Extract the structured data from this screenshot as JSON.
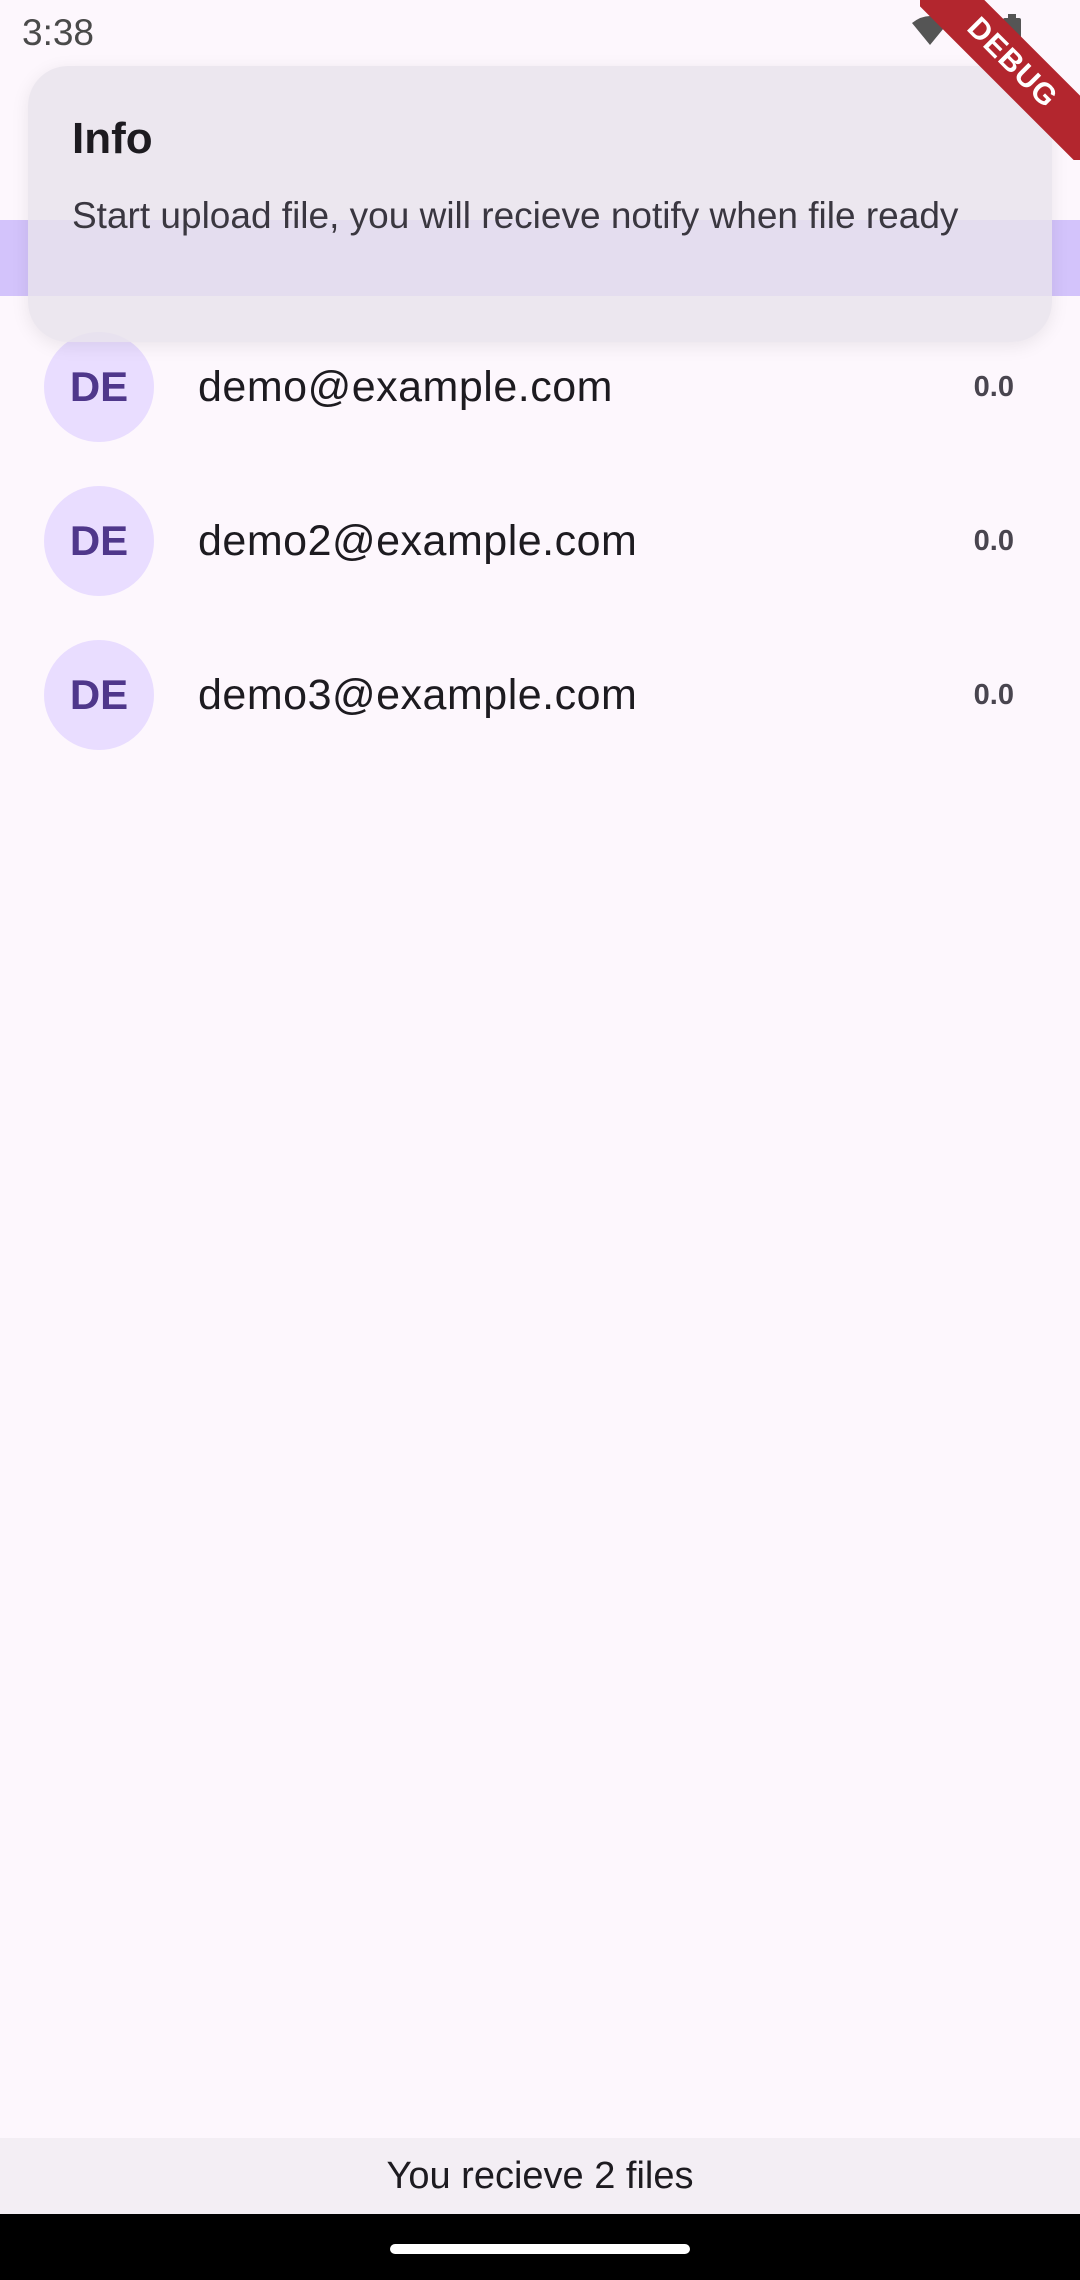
{
  "status_bar": {
    "time": "3:38",
    "icons": [
      "wifi-icon",
      "signal-icon",
      "battery-icon"
    ]
  },
  "debug_banner": {
    "label": "DEBUG"
  },
  "toast": {
    "title": "Info",
    "message": "Start upload file, you will recieve notify when file ready"
  },
  "list": {
    "items": [
      {
        "avatar": "DE",
        "email": "demo@example.com",
        "amount": "0.0"
      },
      {
        "avatar": "DE",
        "email": "demo2@example.com",
        "amount": "0.0"
      },
      {
        "avatar": "DE",
        "email": "demo3@example.com",
        "amount": "0.0"
      }
    ]
  },
  "snackbar": {
    "message": "You recieve 2 files"
  },
  "colors": {
    "background": "#fdf7fd",
    "avatar_bg": "#e9ddff",
    "avatar_text": "#4f378b",
    "banner": "#d3c3fb",
    "debug": "#b3262e"
  }
}
